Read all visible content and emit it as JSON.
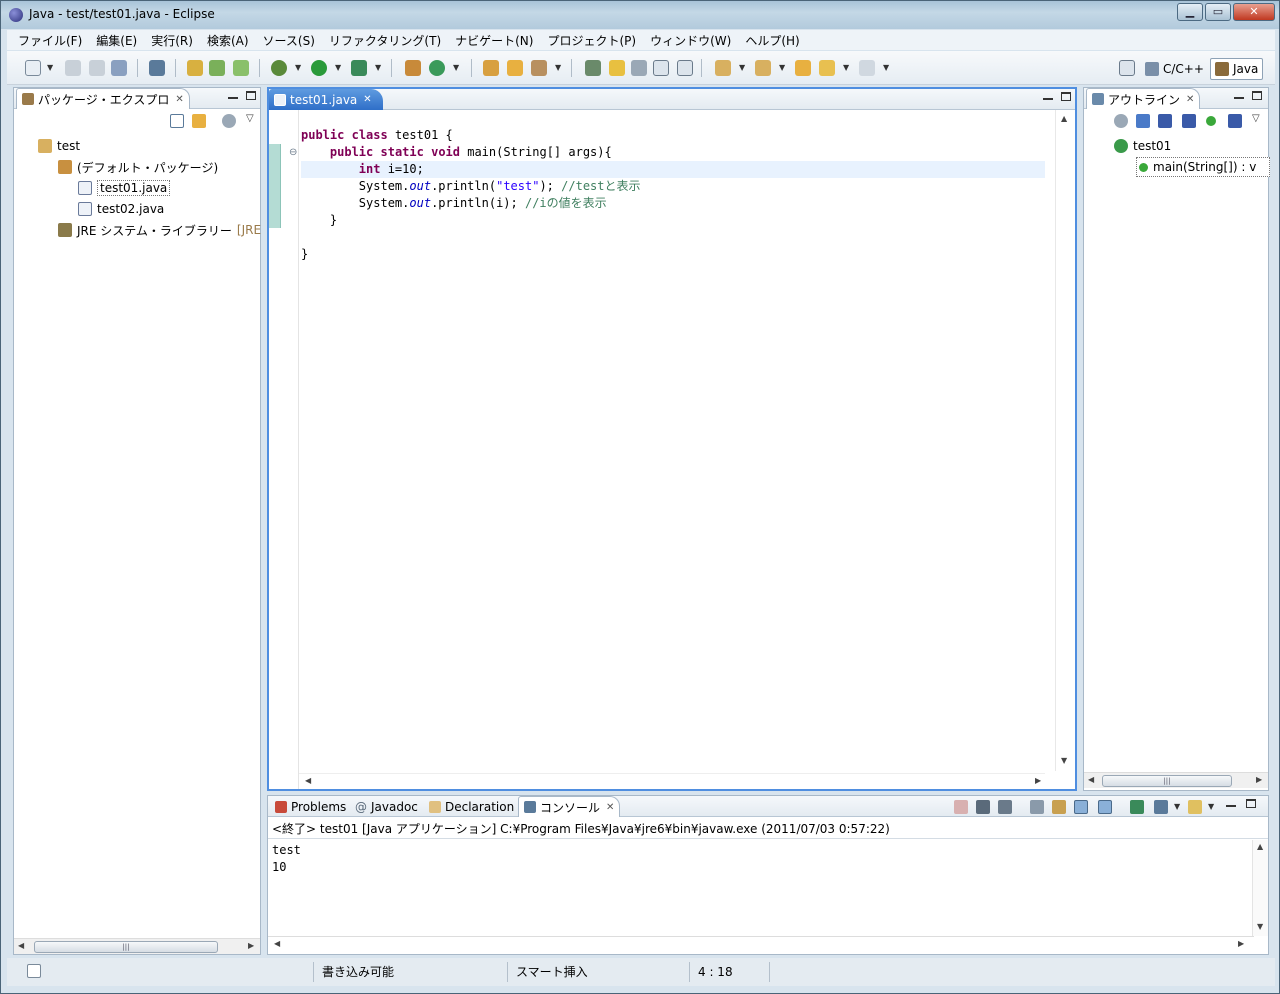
{
  "window": {
    "title": "Java - test/test01.java - Eclipse"
  },
  "menu": [
    "ファイル(F)",
    "編集(E)",
    "実行(R)",
    "検索(A)",
    "ソース(S)",
    "リファクタリング(T)",
    "ナビゲート(N)",
    "プロジェクト(P)",
    "ウィンドウ(W)",
    "ヘルプ(H)"
  ],
  "perspectives": {
    "cpp": "C/C++",
    "java": "Java"
  },
  "package_explorer": {
    "title": "パッケージ・エクスプロ",
    "tree": [
      {
        "label": "test",
        "icon": "project-icon"
      },
      {
        "label": "(デフォルト・パッケージ)",
        "icon": "package-icon"
      },
      {
        "label": "test01.java",
        "icon": "java-file-icon"
      },
      {
        "label": "test02.java",
        "icon": "java-file-icon"
      },
      {
        "label": "JRE システム・ライブラリー",
        "icon": "library-icon",
        "suffix": "[JRE"
      }
    ]
  },
  "editor": {
    "tab": "test01.java",
    "code": {
      "l1_kw1": "public",
      "l1_kw2": "class",
      "l1_rest": " test01 {",
      "l2_kw1": "public",
      "l2_kw2": "static",
      "l2_kw3": "void",
      "l2_rest": " main(String[] args){",
      "l3_kw": "int",
      "l3_rest": " i=10;",
      "l4_a": "System.",
      "l4_field": "out",
      "l4_b": ".println(",
      "l4_str": "\"test\"",
      "l4_c": "); ",
      "l4_cmt": "//testと表示",
      "l5_a": "System.",
      "l5_field": "out",
      "l5_b": ".println(i); ",
      "l5_cmt": "//iの値を表示",
      "l6": "}",
      "l8": "}"
    }
  },
  "outline": {
    "title": "アウトライン",
    "class_name": "test01",
    "method": "main(String[]) : v"
  },
  "bottom": {
    "tabs": {
      "problems": "Problems",
      "javadoc": "Javadoc",
      "declaration": "Declaration",
      "console": "コンソール"
    },
    "console_header": "<終了> test01 [Java アプリケーション] C:¥Program Files¥Java¥jre6¥bin¥javaw.exe (2011/07/03 0:57:22)",
    "output": [
      "test",
      "10"
    ]
  },
  "status": {
    "writable": "書き込み可能",
    "insert_mode": "スマート挿入",
    "position": "4 : 18"
  },
  "colors": {
    "accent": "#4f8ee0",
    "keyword": "#7f0055",
    "string": "#2a00ff",
    "comment": "#3f7f5f",
    "field": "#0000c0"
  }
}
